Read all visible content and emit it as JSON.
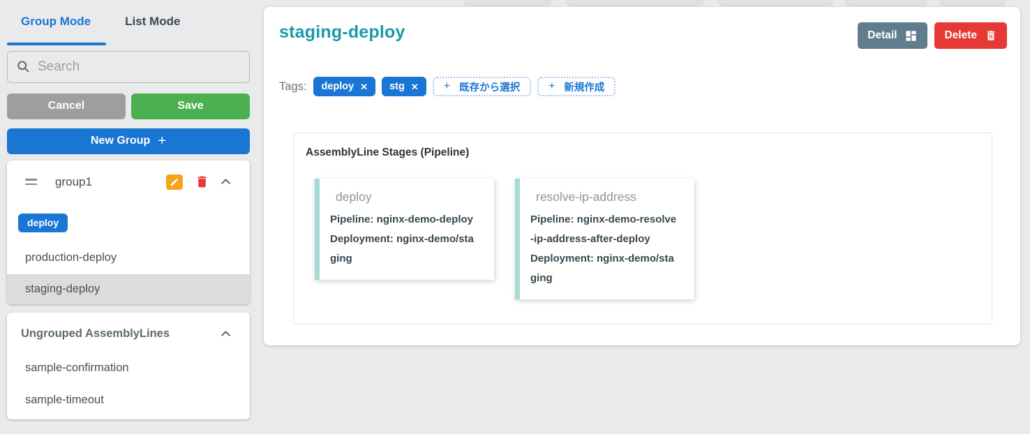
{
  "icons": {
    "close": "✕",
    "plus": "+"
  },
  "colors": {
    "accent_blue": "#1976d2",
    "teal_title": "#1a9aa8",
    "green_save": "#4caf50",
    "gray_cancel": "#9e9e9e",
    "slate_detail": "#607d8b",
    "red_delete": "#e53935",
    "orange_edit": "#f7a41d",
    "stage_border_teal": "#a5dbd3",
    "selected_row": "#dcdcdc"
  },
  "sidebar": {
    "tabs": {
      "group_mode": "Group Mode",
      "list_mode": "List Mode"
    },
    "search_placeholder": "Search",
    "cancel": "Cancel",
    "save": "Save",
    "new_group": "New Group",
    "group": {
      "name": "group1",
      "tag": "deploy",
      "items": [
        {
          "label": "production-deploy",
          "selected": false
        },
        {
          "label": "staging-deploy",
          "selected": true
        }
      ]
    },
    "ungrouped": {
      "title": "Ungrouped AssemblyLines",
      "items": [
        {
          "label": "sample-confirmation"
        },
        {
          "label": "sample-timeout"
        }
      ]
    }
  },
  "main": {
    "title": "staging-deploy",
    "detail": "Detail",
    "delete": "Delete",
    "tags_label": "Tags:",
    "tag_chips": [
      {
        "label": "deploy"
      },
      {
        "label": "stg"
      }
    ],
    "tag_actions": [
      {
        "label": "既存から選択"
      },
      {
        "label": "新規作成"
      }
    ],
    "stages": {
      "title": "AssemblyLine Stages (Pipeline)",
      "cards": [
        {
          "name": "deploy",
          "pipeline": "Pipeline: nginx-demo-deploy",
          "deployment": "Deployment: nginx-demo/staging"
        },
        {
          "name": "resolve-ip-address",
          "pipeline": "Pipeline: nginx-demo-resolve-ip-address-after-deploy",
          "deployment": "Deployment: nginx-demo/staging"
        }
      ]
    }
  }
}
